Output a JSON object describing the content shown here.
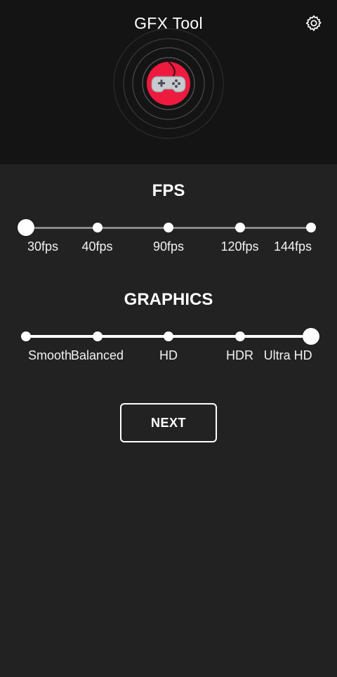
{
  "header": {
    "title": "GFX Tool",
    "settings_icon": "gear-icon",
    "logo_icon": "gamepad-icon",
    "logo_color": "#ee1b3f"
  },
  "fps": {
    "title": "FPS",
    "options": [
      "30fps",
      "40fps",
      "90fps",
      "120fps",
      "144fps"
    ],
    "selected_index": 0
  },
  "graphics": {
    "title": "GRAPHICS",
    "options": [
      "Smooth",
      "Balanced",
      "HD",
      "HDR",
      "Ultra HD"
    ],
    "selected_index": 4
  },
  "next_button": {
    "label": "NEXT"
  },
  "colors": {
    "header_bg": "#141414",
    "body_bg": "#222222",
    "accent": "#ee1b3f"
  }
}
